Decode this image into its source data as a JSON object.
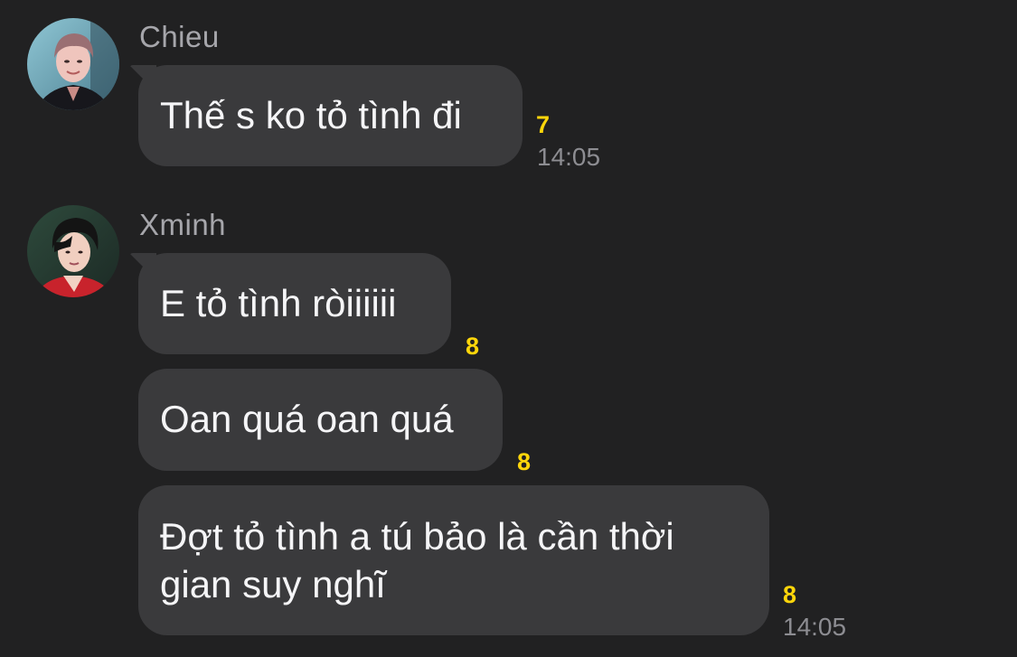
{
  "colors": {
    "background": "#212122",
    "bubble": "#3a3a3c",
    "message_text": "#f5f5f7",
    "sender_name": "#a6a6ab",
    "read_count": "#ffd60a",
    "timestamp": "#8d8d92"
  },
  "messages": [
    {
      "sender": "Chieu",
      "avatar": "avatar-chieu",
      "bubbles": [
        {
          "text": "Thế s ko tỏ tình đi",
          "read_count": "7",
          "time": "14:05"
        }
      ]
    },
    {
      "sender": "Xminh",
      "avatar": "avatar-xminh",
      "bubbles": [
        {
          "text": "E tỏ tình ròiiiiii",
          "read_count": "8",
          "time": ""
        },
        {
          "text": "Oan quá oan quá",
          "read_count": "8",
          "time": ""
        },
        {
          "text_line1": "Đợt tỏ tình a tú bảo là cần thời",
          "text_line2": "gian suy nghĩ",
          "read_count": "8",
          "time": "14:05"
        }
      ]
    }
  ]
}
